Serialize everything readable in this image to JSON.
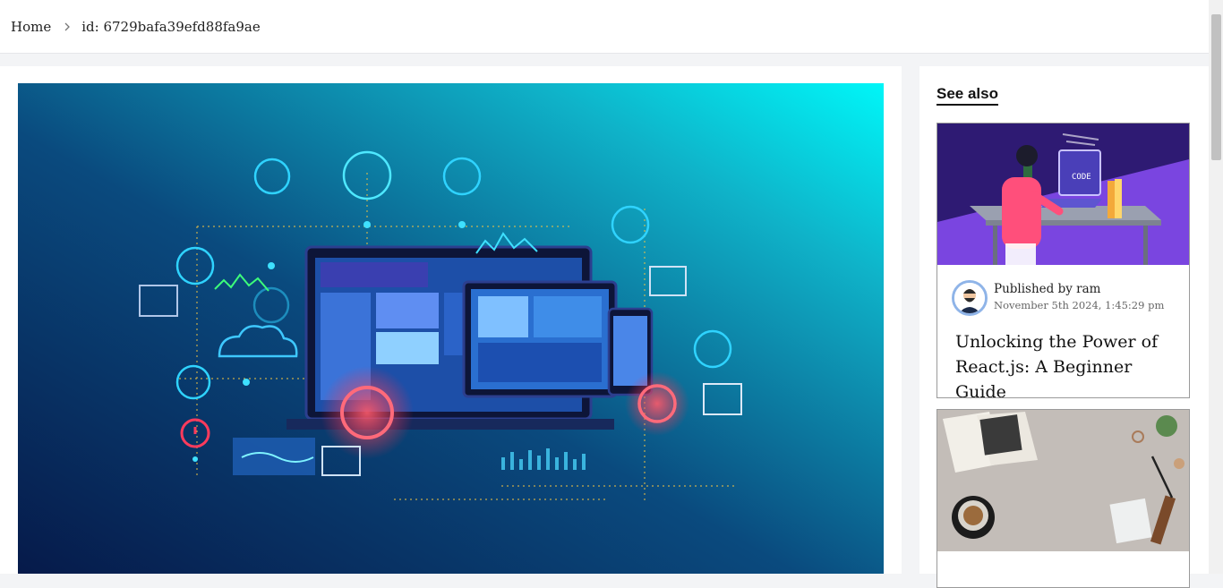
{
  "breadcrumb": {
    "home_label": "Home",
    "current_label": "id: 6729bafa39efd88fa9ae"
  },
  "sidebar": {
    "heading": "See also",
    "cards": [
      {
        "author": "Published by ram",
        "date": "November 5th 2024, 1:45:29 pm",
        "title": "Unlocking the Power of React.js: A Beginner Guide",
        "image": "person-coding-illustration"
      },
      {
        "image": "notebook-coffee-desk-photo"
      }
    ]
  },
  "hero": {
    "image": "web-development-devices-illustration"
  },
  "colors": {
    "accent_purple": "#3a1f8c",
    "hero_dark": "#0a2a5e",
    "hero_light": "#00f0f5"
  }
}
